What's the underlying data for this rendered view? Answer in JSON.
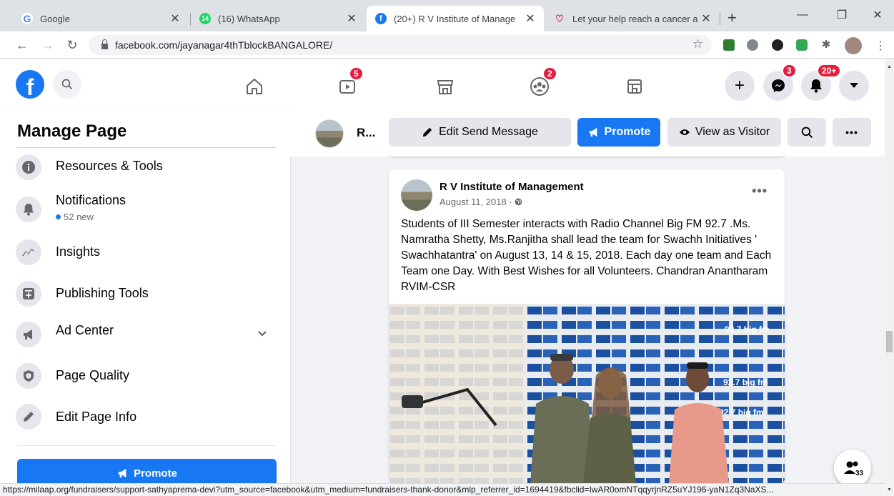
{
  "browser": {
    "tabs": [
      {
        "title": "Google",
        "icon": "google-icon",
        "active": false
      },
      {
        "title": "(16) WhatsApp",
        "icon": "whatsapp-icon",
        "badge": "14",
        "active": false
      },
      {
        "title": "(20+) R V Institute of Manage",
        "icon": "facebook-icon",
        "active": true
      },
      {
        "title": "Let your help reach a cancer a",
        "icon": "milaap-icon",
        "active": false
      }
    ],
    "new_tab": "+",
    "url": "facebook.com/jayanagar4thTblockBANGALORE/",
    "status_url": "https://milaap.org/fundraisers/support-sathyaprema-devi?utm_source=facebook&utm_medium=fundraisers-thank-donor&mlp_referrer_id=1694419&fbclid=IwAR0omNTqqyrjnRZ5uYJ196-yaN1Zq3NaXS..."
  },
  "fb_nav": {
    "watch_badge": "5",
    "groups_badge": "2",
    "messenger_badge": "3",
    "notifications_badge": "20+"
  },
  "sidebar": {
    "title": "Manage Page",
    "items": [
      {
        "label": "Resources & Tools",
        "icon": "info-icon"
      },
      {
        "label": "Notifications",
        "sub": "52 new",
        "icon": "bell-icon"
      },
      {
        "label": "Insights",
        "icon": "insights-icon"
      },
      {
        "label": "Publishing Tools",
        "icon": "publishing-icon"
      },
      {
        "label": "Ad Center",
        "icon": "megaphone-icon"
      },
      {
        "label": "Page Quality",
        "icon": "shield-icon"
      },
      {
        "label": "Edit Page Info",
        "icon": "pencil-icon"
      }
    ],
    "promote_label": "Promote"
  },
  "page_bar": {
    "name": "R...",
    "edit_send_message": "Edit Send Message",
    "promote": "Promote",
    "view_as_visitor": "View as Visitor"
  },
  "post": {
    "author": "R V Institute of Management",
    "date": "August 11, 2018 ·",
    "text": "Students of III Semester interacts with Radio Channel Big FM 92.7 .Ms. Namratha Shetty, Ms.Ranjitha shall lead the team for Swachh Initiatives ' Swachhatantra' on August 13, 14 & 15, 2018. Each day one team and Each Team one Day. With Best Wishes for all Volunteers. Chandran Anantharam RVIM-CSR",
    "image_backdrop_text": "92.7 big fm"
  },
  "contacts_count": "33",
  "colors": {
    "fb_blue": "#1877f2",
    "badge_red": "#e41e3f",
    "bg": "#f0f2f5"
  }
}
